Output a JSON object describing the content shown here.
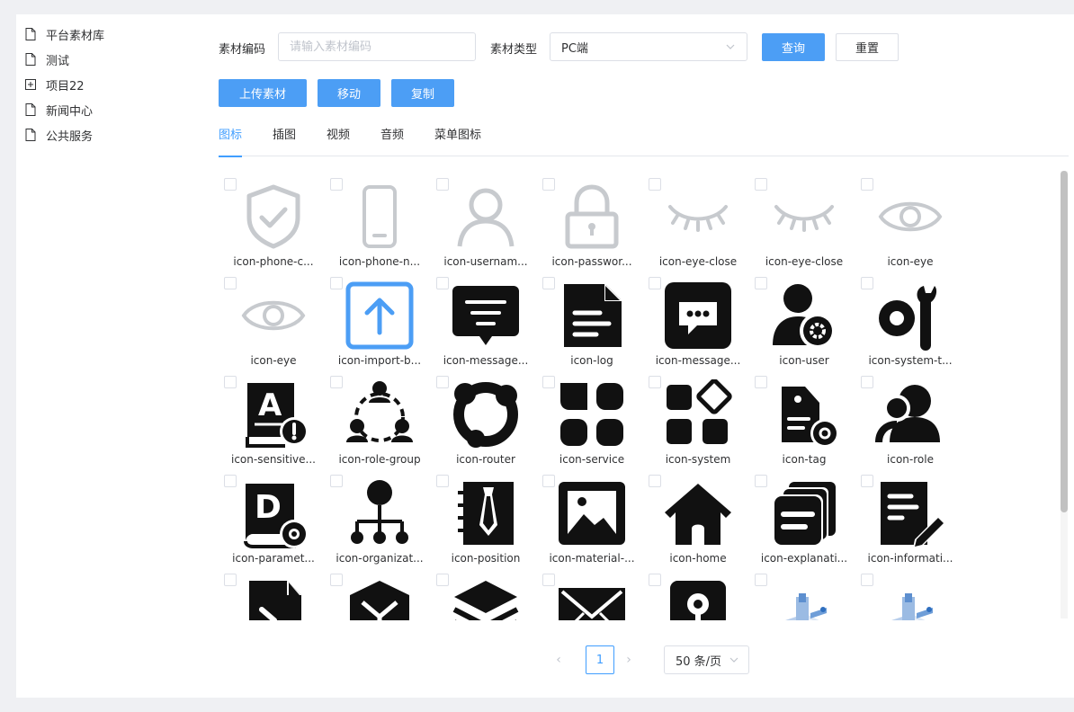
{
  "tree": {
    "items": [
      {
        "label": "平台素材库",
        "icon": "file-icon"
      },
      {
        "label": "测试",
        "icon": "file-icon"
      },
      {
        "label": "项目22",
        "icon": "expand-plus-icon"
      },
      {
        "label": "新闻中心",
        "icon": "file-icon"
      },
      {
        "label": "公共服务",
        "icon": "file-icon"
      }
    ]
  },
  "filters": {
    "code_label": "素材编码",
    "code_placeholder": "请输入素材编码",
    "type_label": "素材类型",
    "type_value": "PC端",
    "query_label": "查询",
    "reset_label": "重置"
  },
  "actions": {
    "upload_label": "上传素材",
    "move_label": "移动",
    "copy_label": "复制"
  },
  "tabs": [
    {
      "label": "图标",
      "active": true
    },
    {
      "label": "插图",
      "active": false
    },
    {
      "label": "视频",
      "active": false
    },
    {
      "label": "音频",
      "active": false
    },
    {
      "label": "菜单图标",
      "active": false
    }
  ],
  "grid": {
    "items": [
      {
        "name": "icon-phone-c...",
        "icon": "shield-check-icon"
      },
      {
        "name": "icon-phone-n...",
        "icon": "phone-icon"
      },
      {
        "name": "icon-usernam...",
        "icon": "user-outline-icon"
      },
      {
        "name": "icon-passwor...",
        "icon": "lock-icon"
      },
      {
        "name": "icon-eye-close",
        "icon": "eye-close-icon"
      },
      {
        "name": "icon-eye-close",
        "icon": "eye-close-icon"
      },
      {
        "name": "icon-eye",
        "icon": "eye-icon"
      },
      {
        "name": "icon-eye",
        "icon": "eye-icon"
      },
      {
        "name": "icon-import-b...",
        "icon": "import-arrow-icon"
      },
      {
        "name": "icon-message...",
        "icon": "message-box-icon"
      },
      {
        "name": "icon-log",
        "icon": "log-document-icon"
      },
      {
        "name": "icon-message...",
        "icon": "chat-bubble-icon"
      },
      {
        "name": "icon-user",
        "icon": "user-gear-icon"
      },
      {
        "name": "icon-system-t...",
        "icon": "system-tools-icon"
      },
      {
        "name": "icon-sensitive...",
        "icon": "sensitive-word-icon"
      },
      {
        "name": "icon-role-group",
        "icon": "role-group-icon"
      },
      {
        "name": "icon-router",
        "icon": "router-icon"
      },
      {
        "name": "icon-service",
        "icon": "service-grid-icon"
      },
      {
        "name": "icon-system",
        "icon": "system-icon"
      },
      {
        "name": "icon-tag",
        "icon": "tag-gear-icon"
      },
      {
        "name": "icon-role",
        "icon": "role-icon"
      },
      {
        "name": "icon-paramet...",
        "icon": "parameter-book-icon"
      },
      {
        "name": "icon-organizat...",
        "icon": "organization-icon"
      },
      {
        "name": "icon-position",
        "icon": "position-tie-icon"
      },
      {
        "name": "icon-material-...",
        "icon": "image-icon"
      },
      {
        "name": "icon-home",
        "icon": "home-icon"
      },
      {
        "name": "icon-explanati...",
        "icon": "explanation-stack-icon"
      },
      {
        "name": "icon-informati...",
        "icon": "information-edit-icon"
      },
      {
        "name": "",
        "icon": "code-file-icon"
      },
      {
        "name": "",
        "icon": "box-icon"
      },
      {
        "name": "",
        "icon": "layers-icon"
      },
      {
        "name": "",
        "icon": "envelope-icon"
      },
      {
        "name": "",
        "icon": "key-shield-icon"
      },
      {
        "name": "",
        "icon": "isometric-illustration-icon"
      },
      {
        "name": "",
        "icon": "isometric-illustration-icon"
      }
    ]
  },
  "pagination": {
    "current_page": "1",
    "page_size": "50 条/页"
  }
}
